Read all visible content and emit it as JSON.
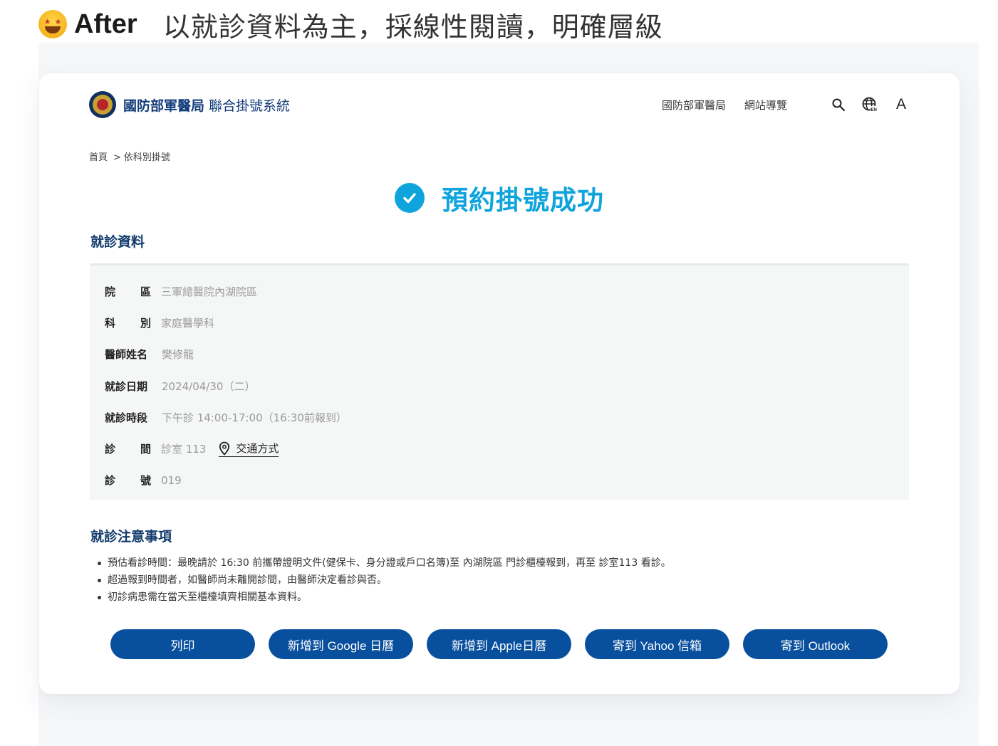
{
  "heading": {
    "emoji_icon": "star-struck-face-icon",
    "tag": "After",
    "description": "以就診資料為主，採線性閱讀，明確層級"
  },
  "site": {
    "brand_main": "國防部軍醫局",
    "brand_sub": "聯合掛號系統",
    "nav": [
      "國防部軍醫局",
      "網站導覽"
    ],
    "icons": [
      "search-icon",
      "globe-language-icon",
      "font-size-icon"
    ],
    "font_size_label": "A"
  },
  "breadcrumb": {
    "home": "首頁",
    "separator": ">",
    "current": "依科別掛號"
  },
  "success": {
    "title": "預約掛號成功",
    "color": "#10a4dd"
  },
  "info": {
    "section_title": "就診資料",
    "rows": [
      {
        "label_a": "院",
        "label_b": "區",
        "value": "三軍總醫院內湖院區"
      },
      {
        "label_a": "科",
        "label_b": "別",
        "value": "家庭醫學科"
      },
      {
        "label": "醫師姓名",
        "value": "樊修龍"
      },
      {
        "label": "就診日期",
        "value": "2024/04/30（二）"
      },
      {
        "label": "就診時段",
        "value": "下午診  14:00-17:00（16:30前報到）"
      },
      {
        "label_a": "診",
        "label_b": "間",
        "value": "診室 113",
        "link": "交通方式"
      },
      {
        "label_a": "診",
        "label_b": "號",
        "value": "019"
      }
    ]
  },
  "notes": {
    "section_title": "就診注意事項",
    "items": [
      "預估看診時間：最晚請於 16:30 前攜帶證明文件(健保卡、身分證或戶口名簿)至 內湖院區 門診櫃檯報到，再至 診室113 看診。",
      "超過報到時間者，如醫師尚未離開診間，由醫師決定看診與否。",
      "初診病患需在當天至櫃檯填齊相關基本資料。"
    ]
  },
  "actions": [
    "列印",
    "新增到 Google 日曆",
    "新增到 Apple日曆",
    "寄到 Yahoo 信箱",
    "寄到 Outlook"
  ],
  "colors": {
    "primary_button": "#084f9d",
    "brand_text": "#123c7a",
    "success": "#10a4dd"
  }
}
